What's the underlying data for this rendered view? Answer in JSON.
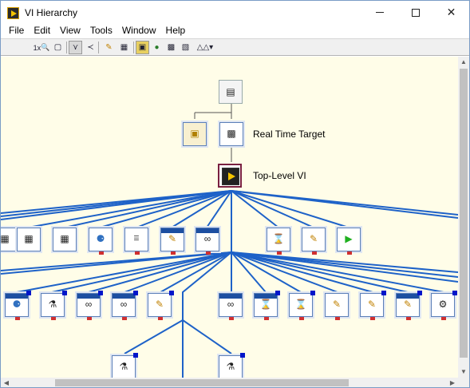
{
  "window": {
    "title": "VI Hierarchy",
    "accent": "#1d4fa1"
  },
  "menu": [
    "File",
    "Edit",
    "View",
    "Tools",
    "Window",
    "Help"
  ],
  "toolbar": {
    "zoom_label": "1x",
    "tools": [
      "zoom-fit-icon",
      "zoom-icon",
      "layout-vertical-icon",
      "layout-horizontal-icon",
      "redo-layout-icon",
      "include-vilib-icon",
      "include-globals-icon",
      "include-typedefs-icon",
      "show-all-vis-icon",
      "labels-icon"
    ]
  },
  "nodes": {
    "project": {
      "label": ""
    },
    "target": {
      "label": "Real Time Target"
    },
    "top_level": {
      "label": "Top-Level VI"
    }
  },
  "level1_icons": [
    "NI-XNET",
    "NI-XNET",
    "NI-XNET",
    "NI-XNET"
  ],
  "level2_icons": [
    "NI-XNET",
    "NI-XNET",
    "NI-XNET",
    "NI-XNET"
  ],
  "node_header": "NI-XNET"
}
